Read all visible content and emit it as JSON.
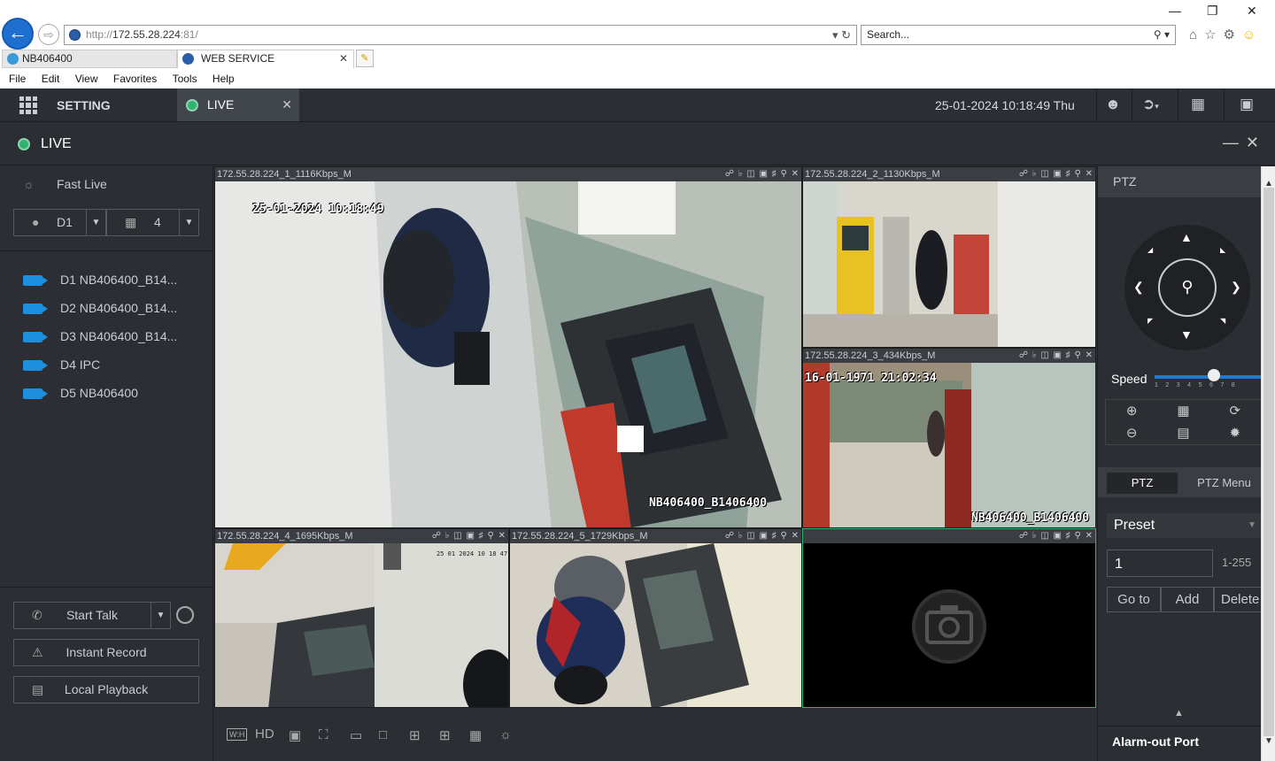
{
  "browser": {
    "url_prefix": "http://",
    "url_host": "172.55.28.224",
    "url_suffix": ":81/",
    "search_placeholder": "Search...",
    "tabs": [
      {
        "label": "NB406400"
      },
      {
        "label": "WEB SERVICE"
      }
    ],
    "menu": [
      "File",
      "Edit",
      "View",
      "Favorites",
      "Tools",
      "Help"
    ]
  },
  "app": {
    "setting_label": "SETTING",
    "live_tab_label": "LIVE",
    "datetime": "25-01-2024 10:18:49 Thu",
    "live_header": "LIVE"
  },
  "sidebar": {
    "fast_live": "Fast Live",
    "channel_select": "D1",
    "layout_select": "4",
    "devices": [
      {
        "label": "D1 NB406400_B14..."
      },
      {
        "label": "D2 NB406400_B14..."
      },
      {
        "label": "D3 NB406400_B14..."
      },
      {
        "label": "D4 IPC"
      },
      {
        "label": "D5 NB406400"
      }
    ],
    "start_talk": "Start Talk",
    "instant_record": "Instant Record",
    "local_playback": "Local Playback"
  },
  "tiles": [
    {
      "title": "172.55.28.224_1_1116Kbps_M",
      "osd_time": "25-01-2024 10:18:49",
      "osd_name": "NB406400_B1406400"
    },
    {
      "title": "172.55.28.224_2_1130Kbps_M"
    },
    {
      "title": "172.55.28.224_3_434Kbps_M",
      "osd_time": "16-01-1971 21:02:34",
      "osd_name": "NB406400_B1406400"
    },
    {
      "title": "172.55.28.224_4_1695Kbps_M",
      "osd_time": "25 01 2024 10 18 47"
    },
    {
      "title": "172.55.28.224_5_1729Kbps_M"
    }
  ],
  "bottom_toolbar": {
    "hd_label": "HD",
    "wh_label": "W:H"
  },
  "ptz": {
    "header": "PTZ",
    "speed_label": "Speed",
    "speed_ticks": "12345678",
    "speed_value": 5,
    "tab_ptz": "PTZ",
    "tab_ptz_menu": "PTZ Menu",
    "preset_label": "Preset",
    "preset_value": "1",
    "preset_range": "1-255",
    "goto_label": "Go to",
    "add_label": "Add",
    "delete_label": "Delete",
    "alarm_out": "Alarm-out Port"
  },
  "colors": {
    "accent_blue": "#1e8fe0",
    "live_green": "#2fb36f",
    "selected_tile_border": "#2fb36f"
  }
}
